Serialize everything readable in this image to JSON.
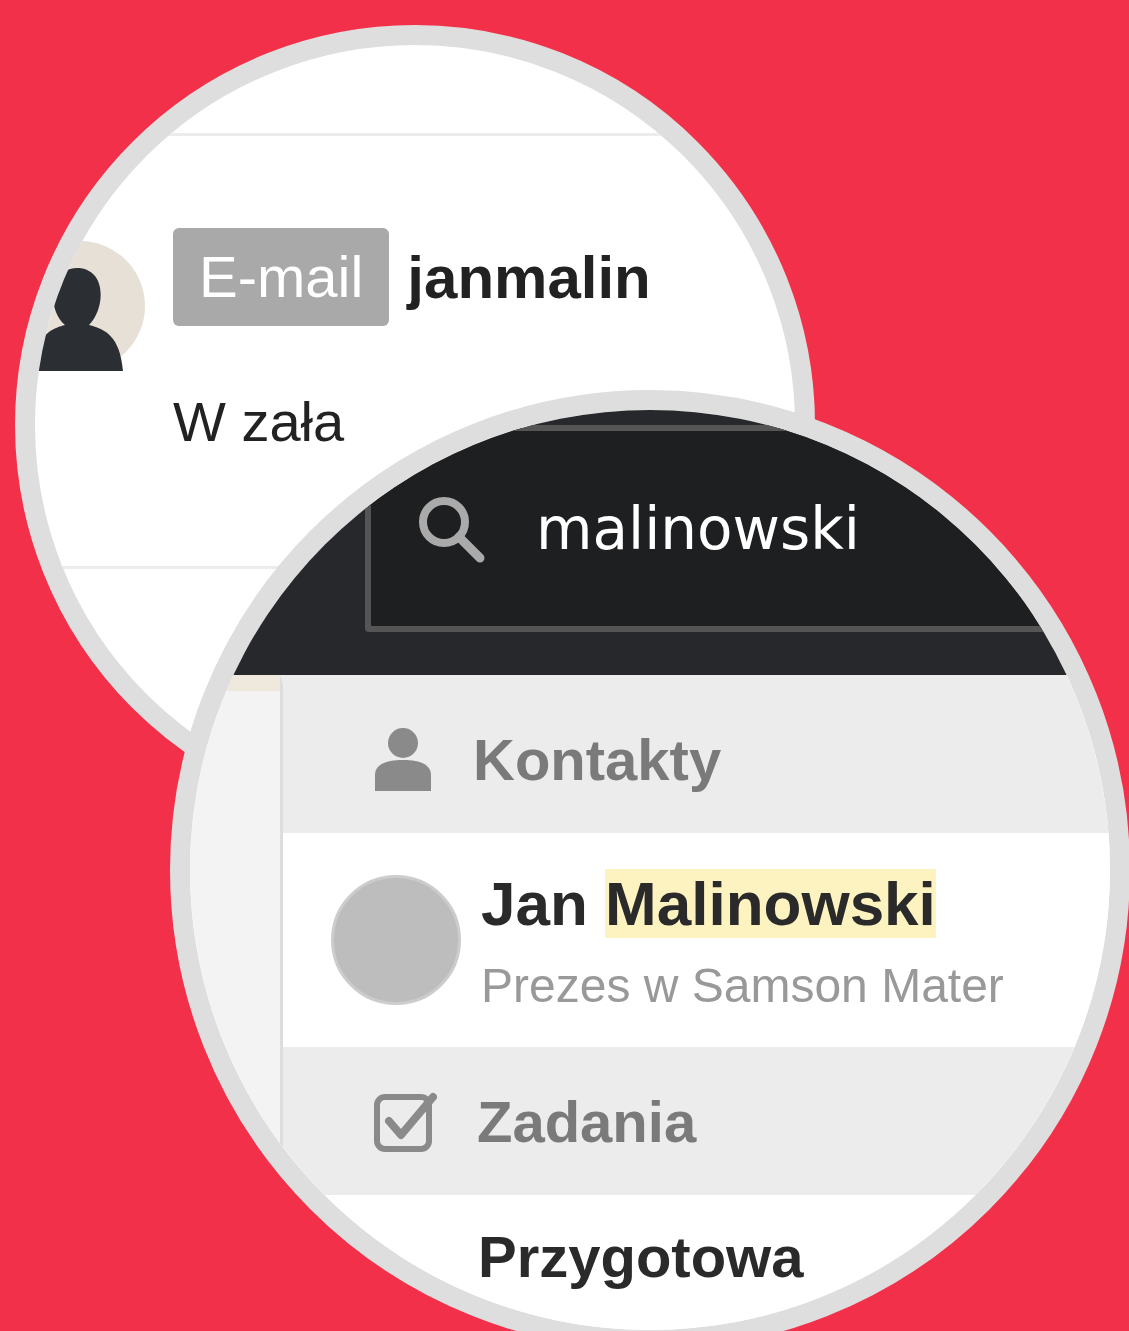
{
  "email_card": {
    "badge": "E-mail",
    "address": "janmalin",
    "body": "W zała"
  },
  "search": {
    "value": "malinowski"
  },
  "results": [
    {
      "kind": "contacts_header",
      "title": "Kontakty"
    },
    {
      "kind": "contact",
      "name": [
        {
          "text": "Jan",
          "highlighted": false
        },
        {
          "text": "Malinowski",
          "highlighted": true
        }
      ],
      "subtitle": "Prezes w Samson Mater"
    },
    {
      "kind": "tasks_header",
      "title": "Zadania"
    },
    {
      "kind": "task",
      "title": "Przygotowa"
    }
  ]
}
